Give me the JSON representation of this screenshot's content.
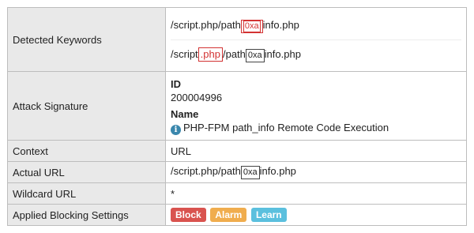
{
  "rows": {
    "detected_keywords": {
      "label": "Detected Keywords",
      "line1": {
        "pre": "/script.php/path",
        "hl": "0xa",
        "post": "info.php"
      },
      "line2": {
        "pre": "/script",
        "hl": ".php",
        "mid": "/path",
        "box": "0xa",
        "post": "info.php"
      }
    },
    "attack_signature": {
      "label": "Attack Signature",
      "id_title": "ID",
      "id_value": "200004996",
      "name_title": "Name",
      "name_value": "PHP-FPM path_info Remote Code Execution",
      "icon": "info-icon"
    },
    "context": {
      "label": "Context",
      "value": "URL"
    },
    "actual_url": {
      "label": "Actual URL",
      "pre": "/script.php/path",
      "box": "0xa",
      "post": "info.php"
    },
    "wildcard_url": {
      "label": "Wildcard URL",
      "value": "*"
    },
    "blocking_settings": {
      "label": "Applied Blocking Settings",
      "badges": {
        "block": {
          "label": "Block",
          "color": "#d9534f"
        },
        "alarm": {
          "label": "Alarm",
          "color": "#f0ad4e"
        },
        "learn": {
          "label": "Learn",
          "color": "#5bc0de"
        }
      }
    }
  }
}
